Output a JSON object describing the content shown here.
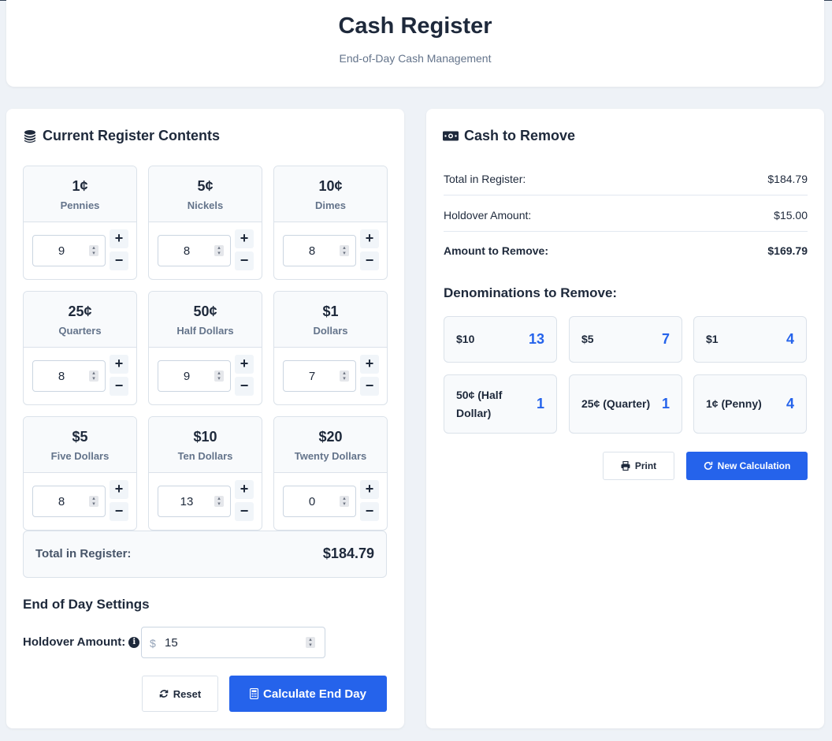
{
  "header": {
    "title": "Cash Register",
    "subtitle": "End-of-Day Cash Management"
  },
  "register": {
    "title": "Current Register Contents",
    "denominations": [
      {
        "value": "1¢",
        "name": "Pennies",
        "count": "9"
      },
      {
        "value": "5¢",
        "name": "Nickels",
        "count": "8"
      },
      {
        "value": "10¢",
        "name": "Dimes",
        "count": "8"
      },
      {
        "value": "25¢",
        "name": "Quarters",
        "count": "8"
      },
      {
        "value": "50¢",
        "name": "Half Dollars",
        "count": "9"
      },
      {
        "value": "$1",
        "name": "Dollars",
        "count": "7"
      },
      {
        "value": "$5",
        "name": "Five Dollars",
        "count": "8"
      },
      {
        "value": "$10",
        "name": "Ten Dollars",
        "count": "13"
      },
      {
        "value": "$20",
        "name": "Twenty Dollars",
        "count": "0"
      }
    ],
    "plus_label": "+",
    "minus_label": "−",
    "total_label": "Total in Register:",
    "total_value": "$184.79"
  },
  "settings": {
    "title": "End of Day Settings",
    "holdover_label": "Holdover Amount:",
    "currency_symbol": "$",
    "holdover_value": "15",
    "reset_label": "Reset",
    "calculate_label": "Calculate End Day"
  },
  "removal": {
    "title": "Cash to Remove",
    "summary": [
      {
        "label": "Total in Register:",
        "value": "$184.79"
      },
      {
        "label": "Holdover Amount:",
        "value": "$15.00"
      },
      {
        "label": "Amount to Remove:",
        "value": "$169.79"
      }
    ],
    "denominations_title": "Denominations to Remove:",
    "items": [
      {
        "label": "$10",
        "count": "13"
      },
      {
        "label": "$5",
        "count": "7"
      },
      {
        "label": "$1",
        "count": "4"
      },
      {
        "label": "50¢ (Half Dollar)",
        "count": "1"
      },
      {
        "label": "25¢ (Quarter)",
        "count": "1"
      },
      {
        "label": "1¢ (Penny)",
        "count": "4"
      }
    ],
    "print_label": "Print",
    "new_label": "New Calculation"
  },
  "colors": {
    "accent": "#2563eb",
    "text": "#1e293b",
    "muted": "#64748b",
    "background": "#eef2f7"
  }
}
